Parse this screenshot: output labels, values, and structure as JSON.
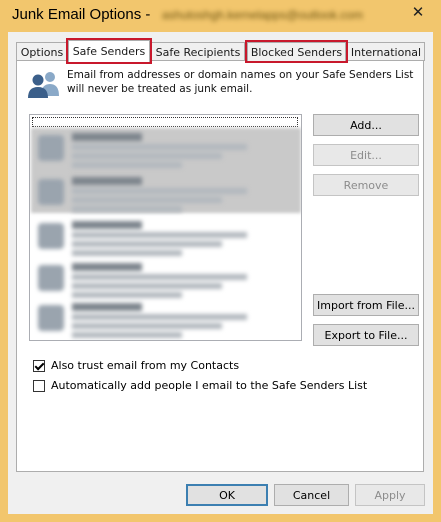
{
  "window": {
    "title": "Junk Email Options -",
    "account": "ashutoshgh.kernelapps@outlook.com",
    "close_glyph": "✕"
  },
  "tabs": [
    {
      "label": "Options",
      "active": false,
      "highlighted": false
    },
    {
      "label": "Safe Senders",
      "active": true,
      "highlighted": true
    },
    {
      "label": "Safe Recipients",
      "active": false,
      "highlighted": false
    },
    {
      "label": "Blocked Senders",
      "active": false,
      "highlighted": true
    },
    {
      "label": "International",
      "active": false,
      "highlighted": false
    }
  ],
  "panel": {
    "icon": "people-icon",
    "description": "Email from addresses or domain names on your Safe Senders List will never be treated as junk email."
  },
  "list": {
    "obscured": true,
    "items": [
      {
        "icon": "blurred-item-icon"
      },
      {
        "icon": "blurred-item-icon"
      },
      {
        "icon": "blurred-item-icon"
      },
      {
        "icon": "blurred-item-icon"
      },
      {
        "icon": "blurred-item-icon"
      }
    ]
  },
  "side_buttons": {
    "add": "Add...",
    "edit": "Edit...",
    "remove": "Remove",
    "import": "Import from File...",
    "export": "Export to File..."
  },
  "checkboxes": {
    "trust_contacts": {
      "label": "Also trust email from my Contacts",
      "checked": true
    },
    "auto_add": {
      "label": "Automatically add people I email to the Safe Senders List",
      "checked": false
    }
  },
  "footer": {
    "ok": "OK",
    "cancel": "Cancel",
    "apply": "Apply"
  },
  "colors": {
    "title_bar": "#f2c66d",
    "highlight_border": "#c8182c",
    "people_icon_blue": "#3b5f8a",
    "people_icon_light": "#8aa9c8"
  }
}
